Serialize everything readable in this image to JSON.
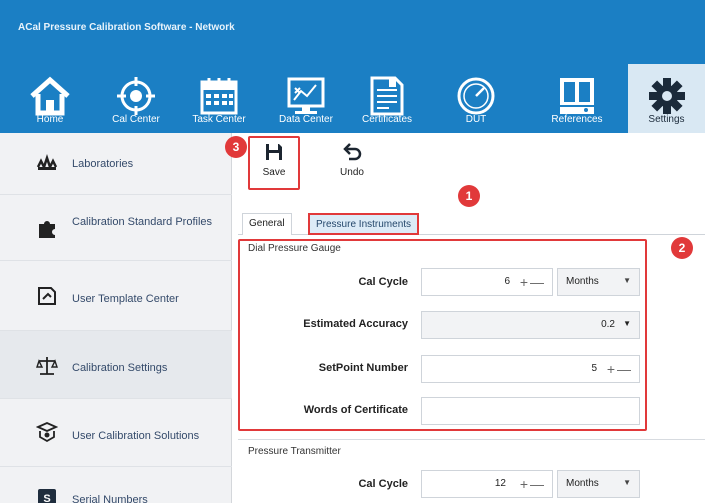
{
  "window": {
    "title": "ACal Pressure Calibration Software - Network"
  },
  "nav": [
    {
      "label": "Home",
      "icon": "home-icon"
    },
    {
      "label": "Cal Center",
      "icon": "target-icon"
    },
    {
      "label": "Task Center",
      "icon": "calendar-icon"
    },
    {
      "label": "Data Center",
      "icon": "chart-monitor-icon"
    },
    {
      "label": "Certificates",
      "icon": "document-icon"
    },
    {
      "label": "DUT",
      "icon": "gauge-icon"
    },
    {
      "label": "References",
      "icon": "references-icon"
    },
    {
      "label": "Settings",
      "icon": "gear-icon",
      "active": true
    }
  ],
  "sidebar": [
    {
      "label": "Laboratories",
      "icon": "lab-people-icon"
    },
    {
      "label": "Calibration Standard Profiles",
      "icon": "puzzle-icon"
    },
    {
      "label": "User Template Center",
      "icon": "template-icon"
    },
    {
      "label": "Calibration Settings",
      "icon": "scales-icon",
      "active": true
    },
    {
      "label": "User Calibration Solutions",
      "icon": "solutions-icon"
    },
    {
      "label": "Serial Numbers",
      "icon": "serial-icon"
    }
  ],
  "toolbar": {
    "save_label": "Save",
    "undo_label": "Undo"
  },
  "tabs": {
    "general": "General",
    "pressure_instruments": "Pressure Instruments"
  },
  "badges": {
    "one": "1",
    "two": "2",
    "three": "3"
  },
  "dial_group": {
    "title": "Dial Pressure Gauge",
    "cal_cycle": {
      "label": "Cal Cycle",
      "value": "6",
      "unit": "Months"
    },
    "estimated_accuracy": {
      "label": "Estimated Accuracy",
      "value": "0.2"
    },
    "setpoint_number": {
      "label": "SetPoint Number",
      "value": "5"
    },
    "words_of_certificate": {
      "label": "Words of Certificate",
      "value": ""
    }
  },
  "transmitter_group": {
    "title": "Pressure Transmitter",
    "cal_cycle": {
      "label": "Cal Cycle",
      "value": "12",
      "unit": "Months"
    }
  },
  "colors": {
    "ribbon": "#1b7fc4",
    "highlight": "#e1393a",
    "active_tab": "#dcebf7"
  }
}
